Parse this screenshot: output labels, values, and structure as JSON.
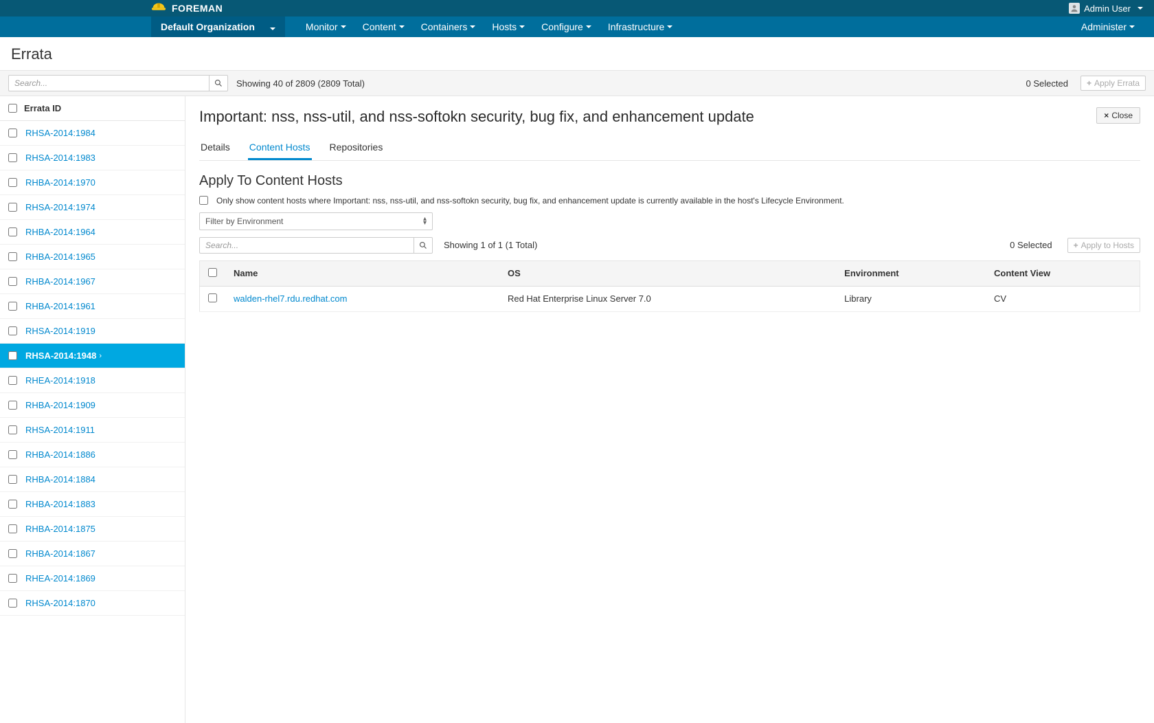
{
  "brand": "FOREMAN",
  "user": {
    "name": "Admin User"
  },
  "org_context": "Default Organization",
  "nav": {
    "items": [
      "Monitor",
      "Content",
      "Containers",
      "Hosts",
      "Configure",
      "Infrastructure"
    ],
    "right": "Administer"
  },
  "page_title": "Errata",
  "toolbar": {
    "search_placeholder": "Search...",
    "count_text": "Showing 40 of 2809 (2809 Total)",
    "selected_text": "0 Selected",
    "apply_label": "Apply Errata"
  },
  "errata_list": {
    "header": "Errata ID",
    "active_index": 9,
    "items": [
      "RHSA-2014:1984",
      "RHSA-2014:1983",
      "RHBA-2014:1970",
      "RHSA-2014:1974",
      "RHBA-2014:1964",
      "RHBA-2014:1965",
      "RHBA-2014:1967",
      "RHBA-2014:1961",
      "RHSA-2014:1919",
      "RHSA-2014:1948",
      "RHEA-2014:1918",
      "RHBA-2014:1909",
      "RHSA-2014:1911",
      "RHBA-2014:1886",
      "RHBA-2014:1884",
      "RHBA-2014:1883",
      "RHBA-2014:1875",
      "RHBA-2014:1867",
      "RHEA-2014:1869",
      "RHSA-2014:1870"
    ]
  },
  "detail": {
    "title": "Important: nss, nss-util, and nss-softokn security, bug fix, and enhancement update",
    "close_label": "Close",
    "tabs": {
      "details": "Details",
      "content_hosts": "Content Hosts",
      "repositories": "Repositories",
      "active": "content_hosts"
    },
    "section_title": "Apply To Content Hosts",
    "filter_checkbox_label": "Only show content hosts where Important: nss, nss-util, and nss-softokn security, bug fix, and enhancement update is currently available in the host's Lifecycle Environment.",
    "env_select_placeholder": "Filter by Environment",
    "hosts_toolbar": {
      "search_placeholder": "Search...",
      "count_text": "Showing 1 of 1 (1 Total)",
      "selected_text": "0 Selected",
      "apply_label": "Apply to Hosts"
    },
    "hosts_table": {
      "columns": {
        "name": "Name",
        "os": "OS",
        "environment": "Environment",
        "content_view": "Content View"
      },
      "rows": [
        {
          "name": "walden-rhel7.rdu.redhat.com",
          "os": "Red Hat Enterprise Linux Server 7.0",
          "environment": "Library",
          "content_view": "CV"
        }
      ]
    }
  }
}
